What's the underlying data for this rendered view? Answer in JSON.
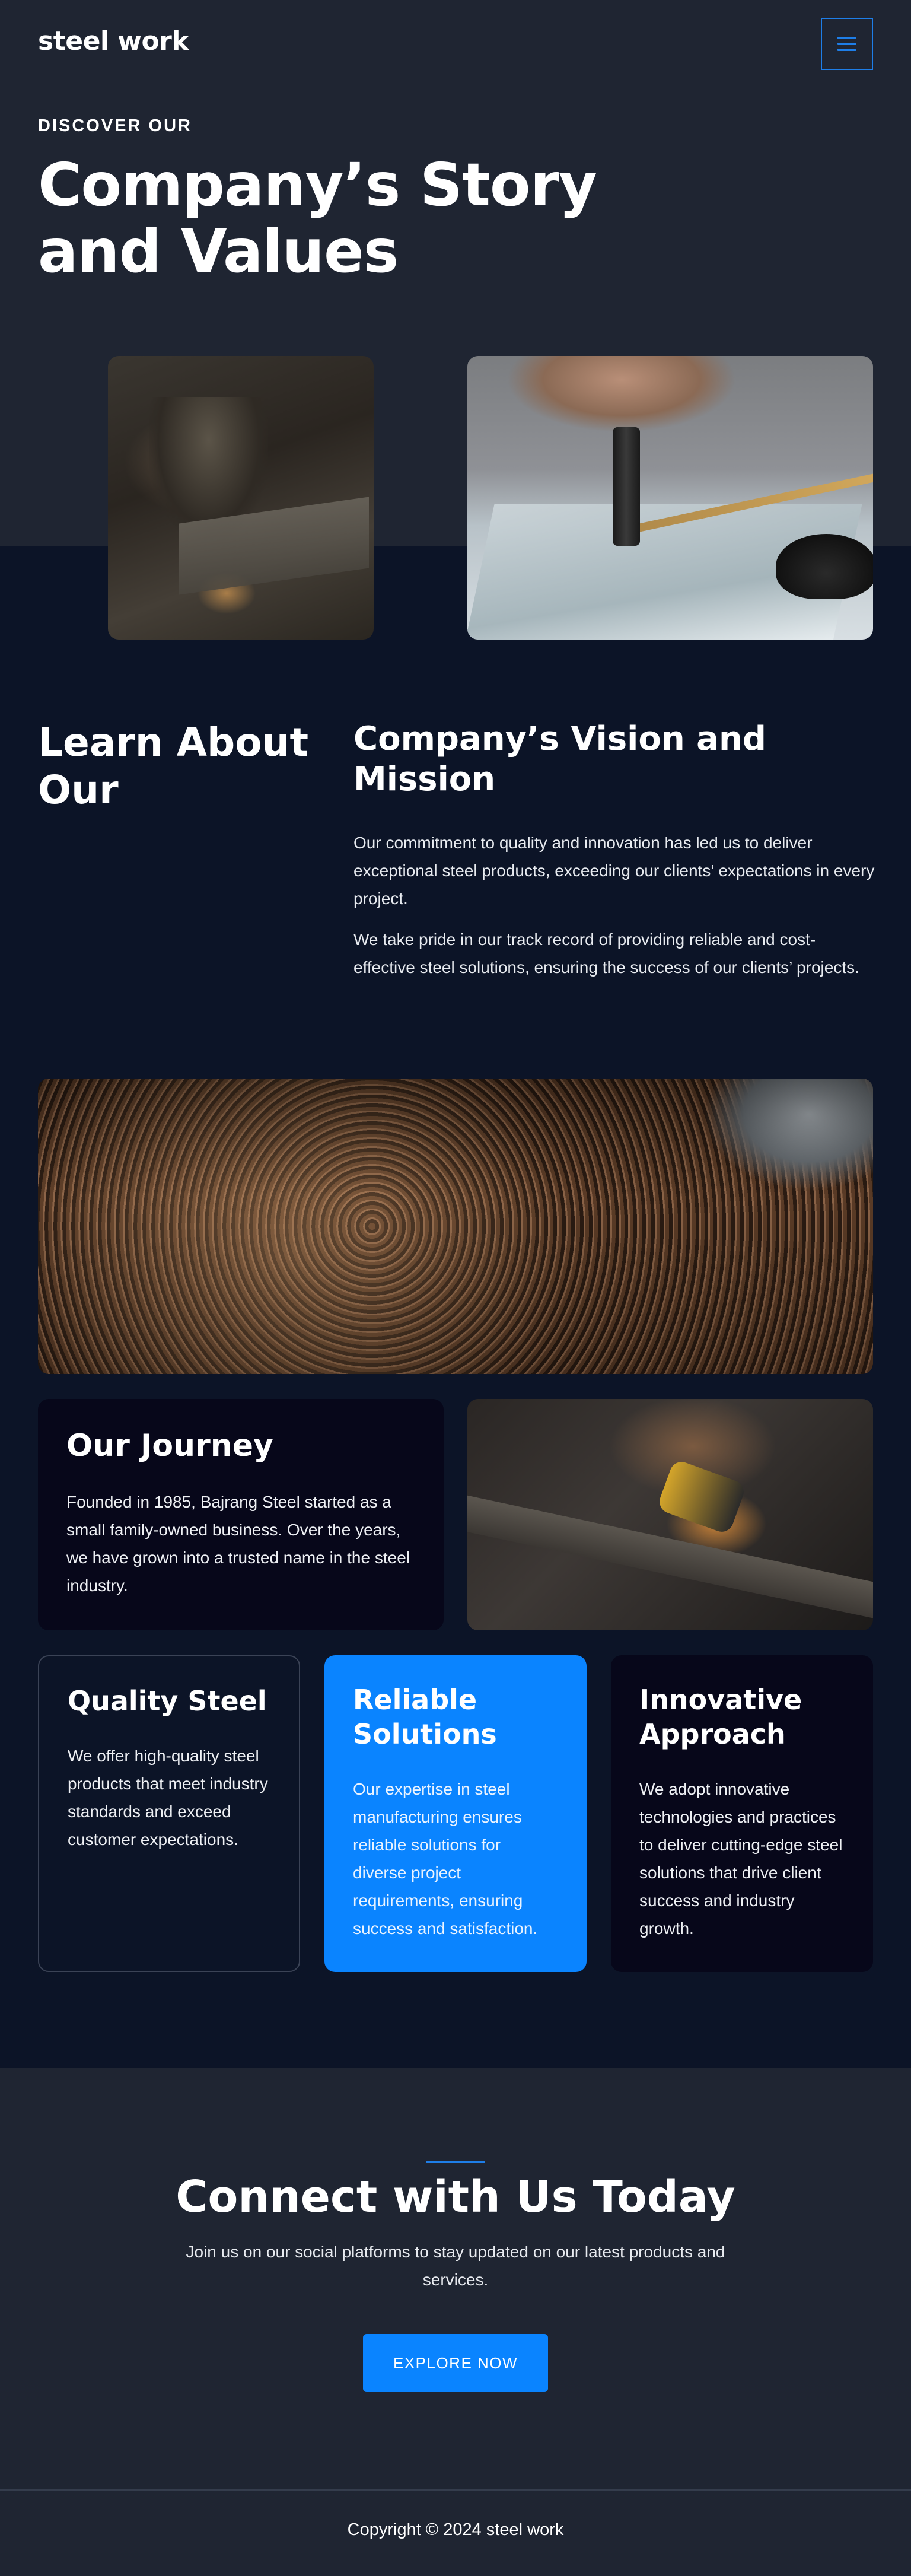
{
  "header": {
    "logo": "steel work",
    "menu_icon": "hamburger-menu-icon"
  },
  "hero": {
    "eyebrow": "DISCOVER OUR",
    "title": "Company’s Story and Values"
  },
  "about": {
    "title": "Learn About Our",
    "vision_title": "Company’s Vision and Mission",
    "paragraphs": [
      "Our commitment to quality and innovation has led us to deliver exceptional steel products, exceeding our clients’ expectations in every project.",
      "We take pride in our track record of providing reliable and cost-effective steel solutions, ensuring the success of our clients’ projects."
    ]
  },
  "journey": {
    "title": "Our Journey",
    "text": "Founded in 1985, Bajrang Steel started as a small family-owned business. Over the years, we have grown into a trusted name in the steel industry."
  },
  "features": [
    {
      "title": "Quality Steel",
      "text": "We offer high-quality steel products that meet industry standards and exceed customer expectations."
    },
    {
      "title": "Reliable Solutions",
      "text": "Our expertise in steel manufacturing ensures reliable solutions for diverse project requirements, ensuring success and satisfaction."
    },
    {
      "title": "Innovative Approach",
      "text": "We adopt innovative technologies and practices to deliver cutting-edge steel solutions that drive client success and industry growth."
    }
  ],
  "connect": {
    "title": "Connect with Us Today",
    "subtitle": "Join us on our social platforms to stay updated on our latest products and services.",
    "cta": "EXPLORE NOW"
  },
  "footer": {
    "copyright": "Copyright © 2024 steel work"
  },
  "colors": {
    "accent": "#0a84ff",
    "header_bg": "#1f2532",
    "body_bg": "#0c1427",
    "card_dark": "#07071a"
  }
}
